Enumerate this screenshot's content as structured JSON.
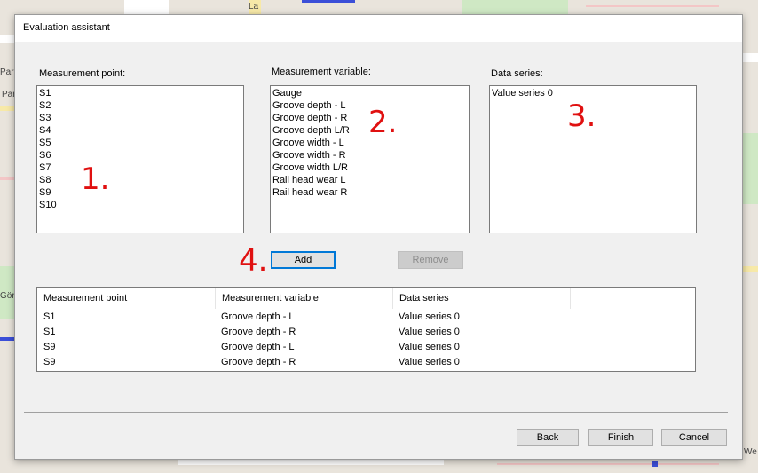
{
  "window": {
    "title": "Evaluation assistant"
  },
  "map_labels": [
    "Paris",
    "Par",
    "Gör",
    "We",
    "La"
  ],
  "measurement_point": {
    "label": "Measurement point:",
    "items": [
      "S1",
      "S2",
      "S3",
      "S4",
      "S5",
      "S6",
      "S7",
      "S8",
      "S9",
      "S10"
    ]
  },
  "measurement_variable": {
    "label": "Measurement variable:",
    "items": [
      "Gauge",
      "Groove depth - L",
      "Groove depth - R",
      "Groove depth L/R",
      "Groove width - L",
      "Groove width - R",
      "Groove width L/R",
      "Rail head wear L",
      "Rail head wear R"
    ]
  },
  "data_series": {
    "label": "Data series:",
    "items": [
      "Value series 0"
    ]
  },
  "annotations": [
    "1.",
    "2.",
    "3.",
    "4."
  ],
  "actions": {
    "add": "Add",
    "remove": "Remove"
  },
  "table": {
    "columns": [
      "Measurement point",
      "Measurement variable",
      "Data series"
    ],
    "rows": [
      [
        "S1",
        "Groove depth - L",
        "Value series 0"
      ],
      [
        "S1",
        "Groove depth - R",
        "Value series 0"
      ],
      [
        "S9",
        "Groove depth - L",
        "Value series 0"
      ],
      [
        "S9",
        "Groove depth - R",
        "Value series 0"
      ]
    ]
  },
  "footer": {
    "back": "Back",
    "finish": "Finish",
    "cancel": "Cancel"
  }
}
